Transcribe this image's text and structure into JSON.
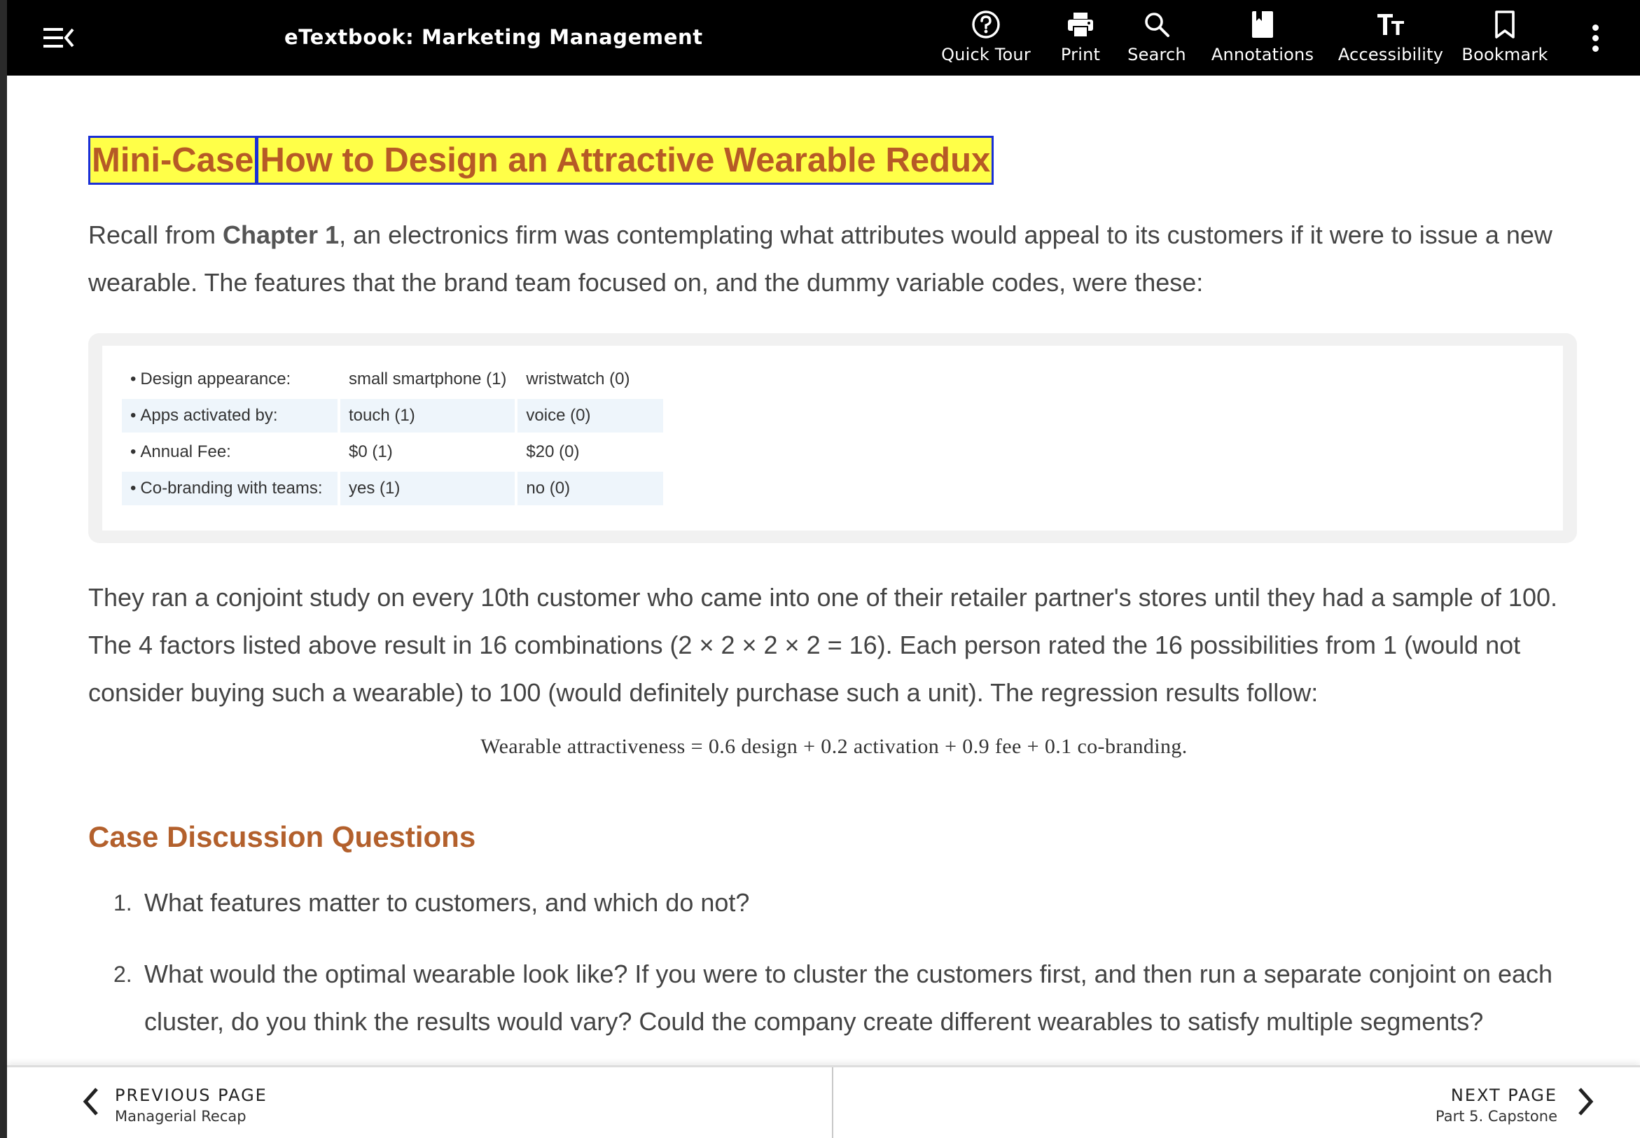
{
  "header": {
    "title": "eTextbook: Marketing Management",
    "tools": [
      {
        "label": "Quick Tour",
        "icon": "help-circle-icon"
      },
      {
        "label": "Print",
        "icon": "printer-icon"
      },
      {
        "label": "Search",
        "icon": "search-icon"
      },
      {
        "label": "Annotations",
        "icon": "annotation-icon"
      },
      {
        "label": "Accessibility",
        "icon": "text-size-icon"
      },
      {
        "label": "Bookmark",
        "icon": "bookmark-icon"
      }
    ]
  },
  "case": {
    "label": "Mini-Case",
    "title": "How to Design an Attractive Wearable Redux",
    "intro_pre": "Recall from ",
    "intro_link": "Chapter 1",
    "intro_post": ", an electronics firm was contemplating what attributes would appeal to its customers if it were to issue a new wearable. The features that the brand team focused on, and the dummy variable codes, were these:",
    "features": [
      {
        "name": "Design appearance:",
        "opt1": "small smartphone (1)",
        "opt2": "wristwatch (0)"
      },
      {
        "name": "Apps activated by:",
        "opt1": "touch (1)",
        "opt2": "voice (0)"
      },
      {
        "name": "Annual Fee:",
        "opt1": "$0 (1)",
        "opt2": "$20 (0)"
      },
      {
        "name": "Co-branding with teams:",
        "opt1": "yes (1)",
        "opt2": "no (0)"
      }
    ],
    "study_text": "They ran a conjoint study on every 10th customer who came into one of their retailer partner's stores until they had a sample of 100. The 4 factors listed above result in 16 combinations (2 × 2 × 2 × 2 = 16). Each person rated the 16 possibilities from 1 (would not consider buying such a wearable) to 100 (would definitely purchase such a unit). The regression results follow:",
    "equation": "Wearable attractiveness =  0.6 design + 0.2 activation + 0.9 fee + 0.1 co-branding."
  },
  "discussion": {
    "heading": "Case Discussion Questions",
    "questions": [
      {
        "num": "1.",
        "text": "What features matter to customers, and which do not?"
      },
      {
        "num": "2.",
        "text": "What would the optimal wearable look like? If you were to cluster the customers first, and then run a separate conjoint on each cluster, do you think the results would vary? Could the company create different wearables to satisfy multiple segments?"
      }
    ]
  },
  "footer": {
    "prev_label": "PREVIOUS PAGE",
    "prev_title": "Managerial Recap",
    "next_label": "NEXT PAGE",
    "next_title": "Part 5. Capstone"
  }
}
